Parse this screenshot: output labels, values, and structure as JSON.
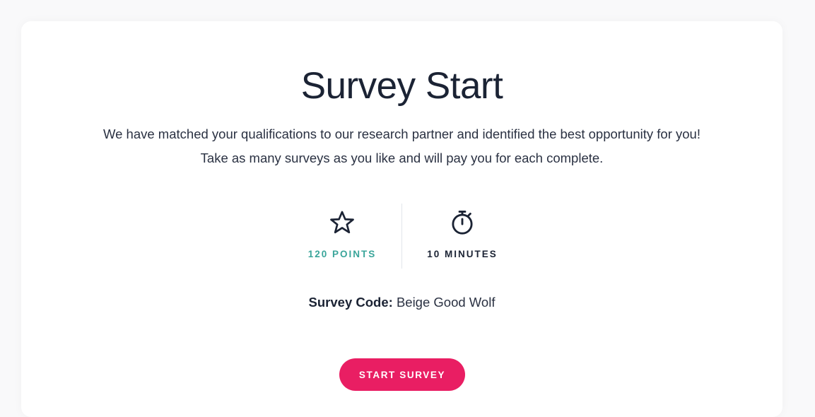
{
  "page": {
    "title": "Survey Start",
    "description": "We have matched your qualifications to our research partner and identified the best opportunity for you! Take as many surveys as you like and will pay you for each complete."
  },
  "stats": {
    "points": {
      "label": "120 POINTS",
      "icon": "star-icon",
      "color": "#3aa59a"
    },
    "duration": {
      "label": "10 MINUTES",
      "icon": "stopwatch-icon",
      "color": "#1b2334"
    }
  },
  "survey_code": {
    "label": "Survey Code:",
    "value": "Beige Good Wolf"
  },
  "actions": {
    "start_label": "START SURVEY",
    "start_color": "#e91e63"
  }
}
